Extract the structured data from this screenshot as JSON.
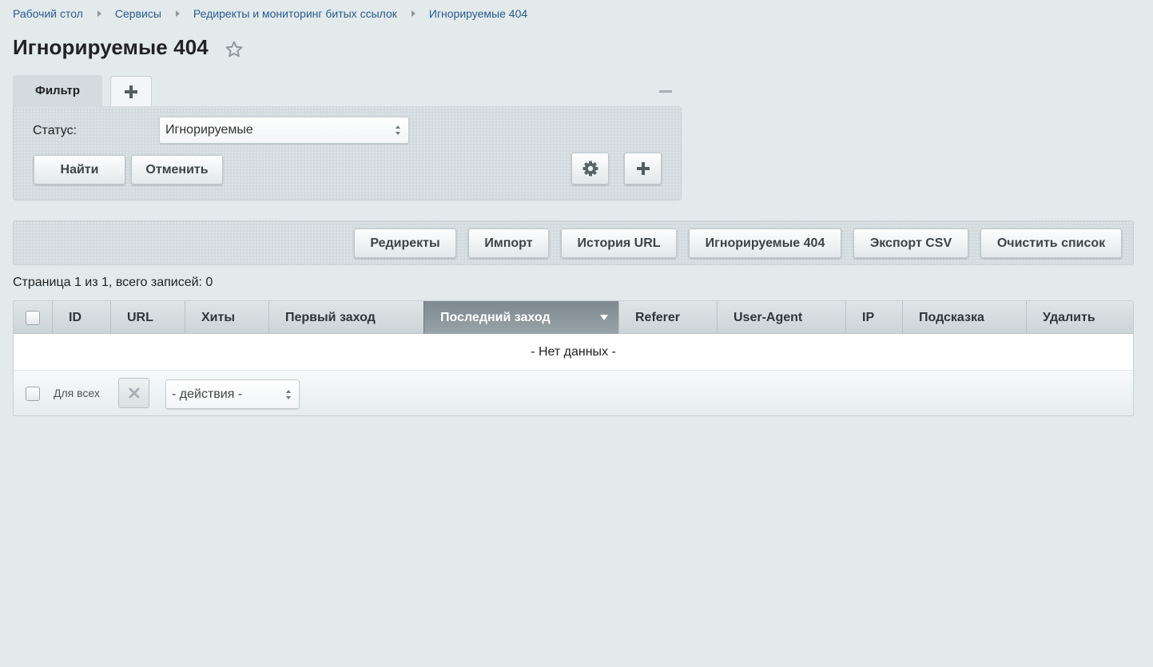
{
  "breadcrumb": [
    {
      "label": "Рабочий стол"
    },
    {
      "label": "Сервисы"
    },
    {
      "label": "Редиректы и мониторинг битых ссылок"
    },
    {
      "label": "Игнорируемые 404"
    }
  ],
  "page": {
    "title": "Игнорируемые 404",
    "favorite_icon": "star-icon"
  },
  "filter": {
    "tab_label": "Фильтр",
    "add_tab_icon": "plus-icon",
    "collapse_icon": "minus-icon",
    "status_label": "Статус:",
    "status_value": "Игнорируемые",
    "find_label": "Найти",
    "cancel_label": "Отменить",
    "settings_icon": "gear-icon",
    "add_icon": "plus-icon"
  },
  "toolbar": {
    "buttons": [
      "Редиректы",
      "Импорт",
      "История URL",
      "Игнорируемые 404",
      "Экспорт CSV",
      "Очистить список"
    ]
  },
  "pager": {
    "text": "Страница 1 из 1, всего записей: 0"
  },
  "grid": {
    "columns": [
      "ID",
      "URL",
      "Хиты",
      "Первый заход",
      "Последний заход",
      "Referer",
      "User-Agent",
      "IP",
      "Подсказка",
      "Удалить"
    ],
    "sorted_column": "Последний заход",
    "empty_text": "- Нет данных -",
    "footer": {
      "for_all_label": "Для всех",
      "delete_icon": "close-icon",
      "actions_value": "- действия -"
    }
  },
  "colors": {
    "background": "#e3eaec",
    "link": "#2a5b8c",
    "sorted_header": "#8a959a"
  }
}
